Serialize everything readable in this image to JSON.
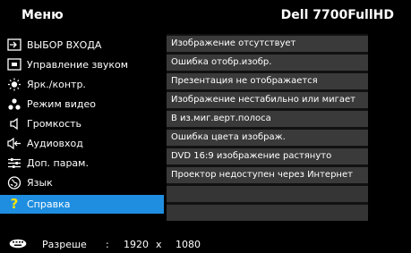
{
  "header": {
    "title": "Меню",
    "model": "Dell 7700FullHD"
  },
  "menu": [
    {
      "label": "ВЫБОР ВХОДА",
      "icon": "input-source-icon"
    },
    {
      "label": "Управление звуком",
      "icon": "audio-control-icon"
    },
    {
      "label": "Ярк./контр.",
      "icon": "brightness-icon"
    },
    {
      "label": "Режим видео",
      "icon": "video-mode-icon"
    },
    {
      "label": "Громкость",
      "icon": "speaker-icon"
    },
    {
      "label": "Аудиовход",
      "icon": "audio-input-icon"
    },
    {
      "label": "Доп. парам.",
      "icon": "advanced-settings-icon"
    },
    {
      "label": "Язык",
      "icon": "language-globe-icon"
    },
    {
      "label": "Справка",
      "icon": "help-question-icon",
      "active": true
    }
  ],
  "help_items": [
    "Изображение отсутствует",
    "Ошибка отобр.изобр.",
    "Презентация не отображается",
    "Изображение нестабильно или мигает",
    "В из.миг.верт.полоса",
    "Ошибка цвета изображ.",
    "DVD 16:9 изображение растянуто",
    "Проектор недоступен через Интернет",
    "",
    ""
  ],
  "status": {
    "label": "Разреше",
    "separator": ":",
    "width": "1920",
    "times": "x",
    "height": "1080"
  },
  "colors": {
    "highlight": "#1f8ee0",
    "help_icon": "#ffe600",
    "item_bg": "#3a3a3a"
  }
}
